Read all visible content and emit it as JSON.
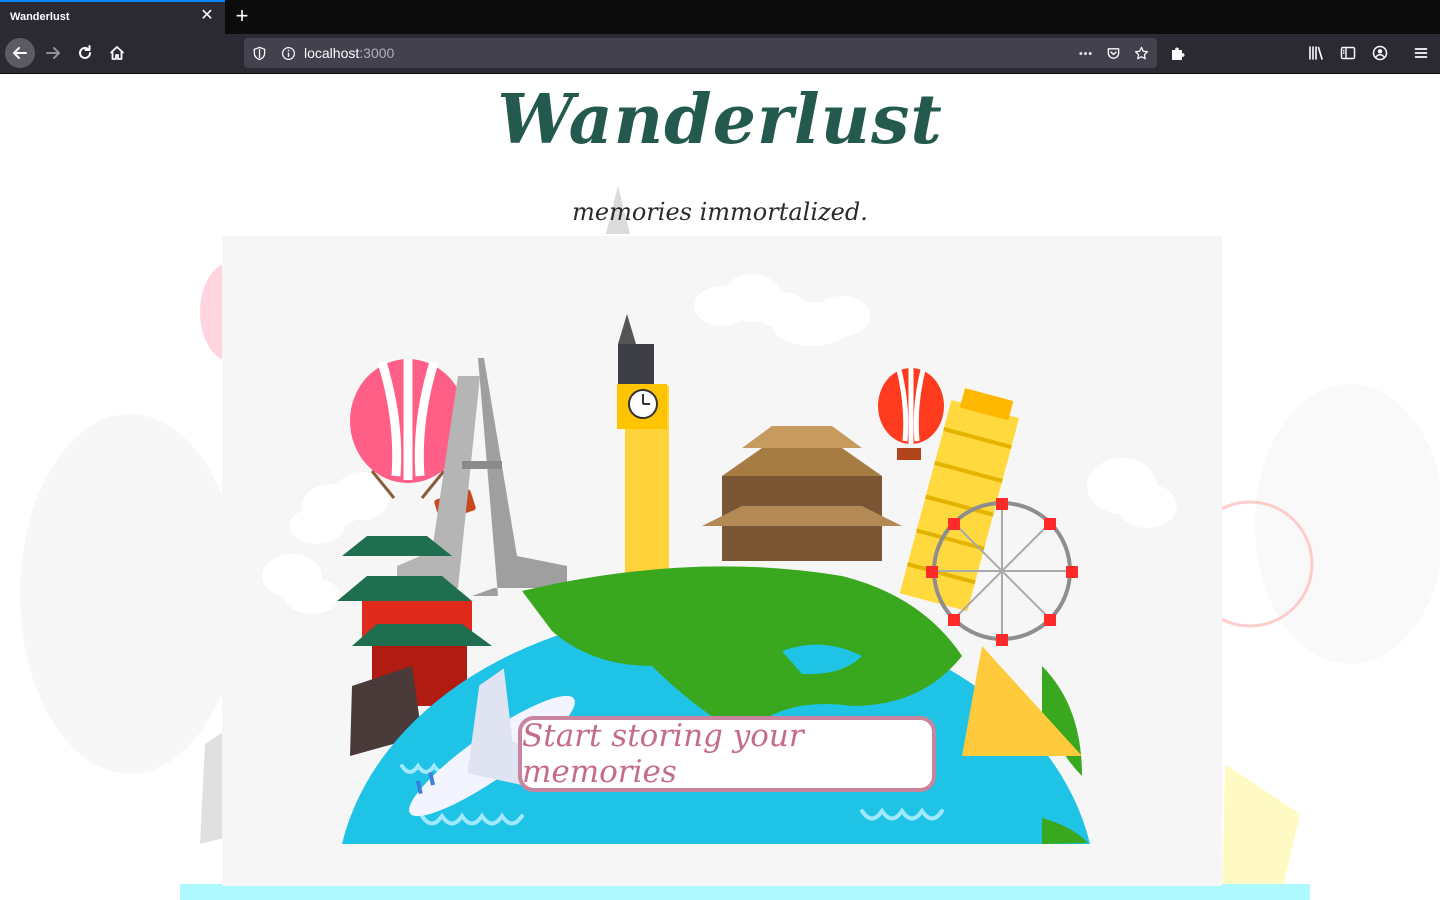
{
  "browser": {
    "tab": {
      "title": "Wanderlust"
    },
    "url": {
      "host": "localhost",
      "port": ":3000"
    },
    "toolbar_icons": [
      "back-arrow-icon",
      "forward-arrow-icon",
      "reload-icon",
      "home-icon",
      "shield-icon",
      "info-icon",
      "more-icon",
      "pocket-icon",
      "star-icon",
      "extensions-icon",
      "library-icon",
      "sidebar-icon",
      "account-icon",
      "menu-icon"
    ]
  },
  "page": {
    "title": "Wanderlust",
    "tagline": "memories immortalized.",
    "cta_label": "Start storing your memories"
  },
  "colors": {
    "title": "#235a4d",
    "cta_border": "#c9849e",
    "cta_text": "#c46b8e",
    "ocean": "#1ec3e6",
    "land": "#3aa81e"
  }
}
